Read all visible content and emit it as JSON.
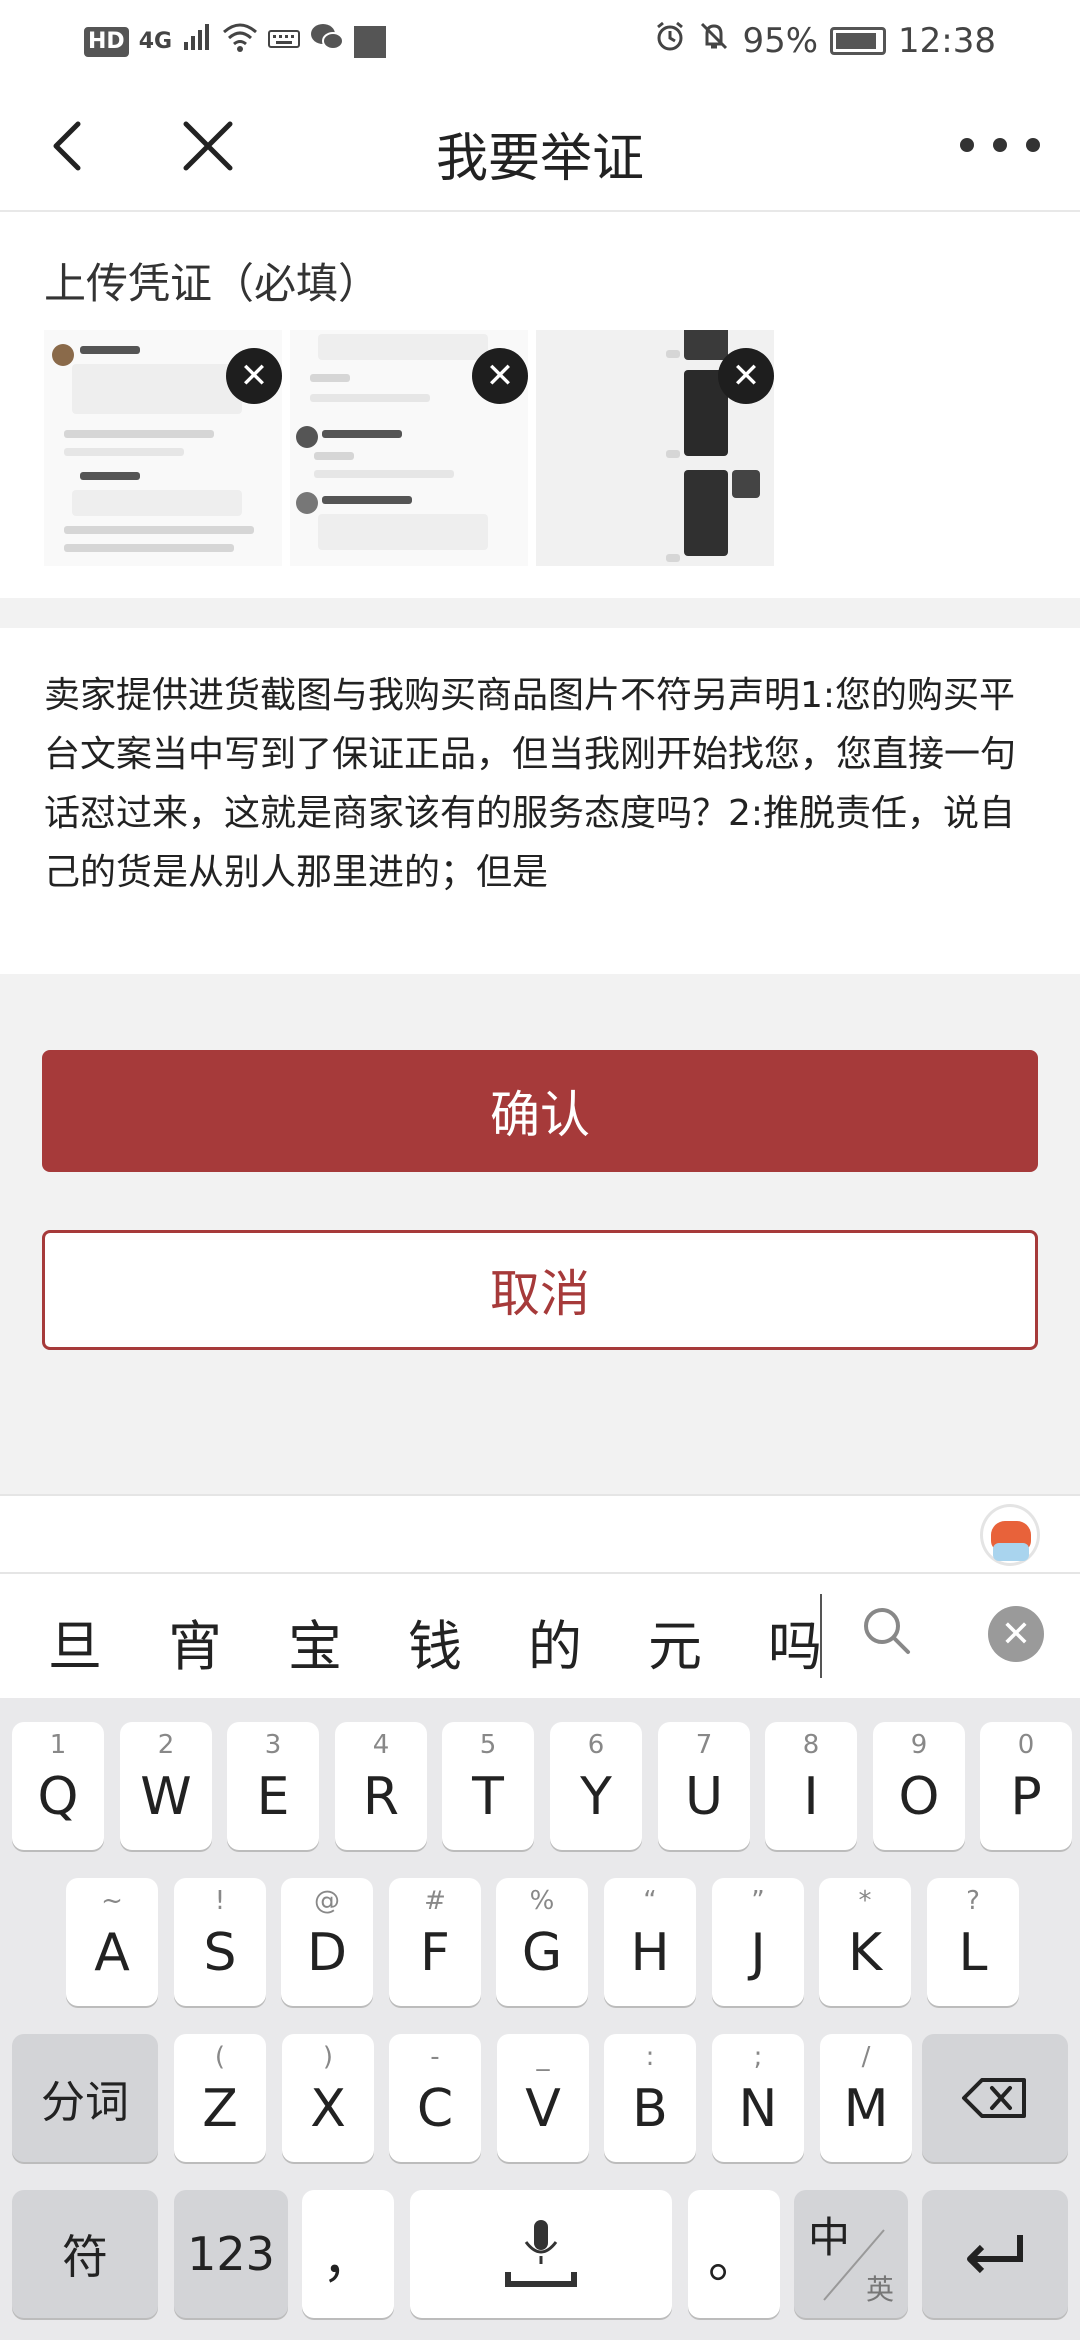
{
  "status_bar": {
    "hd": "HD",
    "network": "4G",
    "battery_percent": "95%",
    "time": "12:38"
  },
  "nav": {
    "title": "我要举证"
  },
  "upload": {
    "title": "上传凭证（必填）",
    "thumbnail_count": 3
  },
  "description": {
    "text": "卖家提供进货截图与我购买商品图片不符另声明1:您的购买平台文案当中写到了保证正品，但当我刚开始找您，您直接一句话怼过来，这就是商家该有的服务态度吗？2:推脱责任，说自己的货是从别人那里进的；但是"
  },
  "buttons": {
    "confirm": "确认",
    "cancel": "取消"
  },
  "ime": {
    "candidates": [
      "旦",
      "宵",
      "宝",
      "钱",
      "的",
      "元",
      "吗"
    ],
    "rows": [
      [
        {
          "main": "Q",
          "sub": "1"
        },
        {
          "main": "W",
          "sub": "2"
        },
        {
          "main": "E",
          "sub": "3"
        },
        {
          "main": "R",
          "sub": "4"
        },
        {
          "main": "T",
          "sub": "5"
        },
        {
          "main": "Y",
          "sub": "6"
        },
        {
          "main": "U",
          "sub": "7"
        },
        {
          "main": "I",
          "sub": "8"
        },
        {
          "main": "O",
          "sub": "9"
        },
        {
          "main": "P",
          "sub": "0"
        }
      ],
      [
        {
          "main": "A",
          "sub": "~"
        },
        {
          "main": "S",
          "sub": "!"
        },
        {
          "main": "D",
          "sub": "@"
        },
        {
          "main": "F",
          "sub": "#"
        },
        {
          "main": "G",
          "sub": "%"
        },
        {
          "main": "H",
          "sub": "“"
        },
        {
          "main": "J",
          "sub": "”"
        },
        {
          "main": "K",
          "sub": "*"
        },
        {
          "main": "L",
          "sub": "?"
        }
      ],
      [
        {
          "main": "Z",
          "sub": "("
        },
        {
          "main": "X",
          "sub": ")"
        },
        {
          "main": "C",
          "sub": "-"
        },
        {
          "main": "V",
          "sub": "_"
        },
        {
          "main": "B",
          "sub": ":"
        },
        {
          "main": "N",
          "sub": ";"
        },
        {
          "main": "M",
          "sub": "/"
        }
      ]
    ],
    "fenci": "分词",
    "fu": "符",
    "num": "123",
    "comma": "，",
    "period": "。",
    "lang_zh": "中",
    "lang_en": "英"
  }
}
